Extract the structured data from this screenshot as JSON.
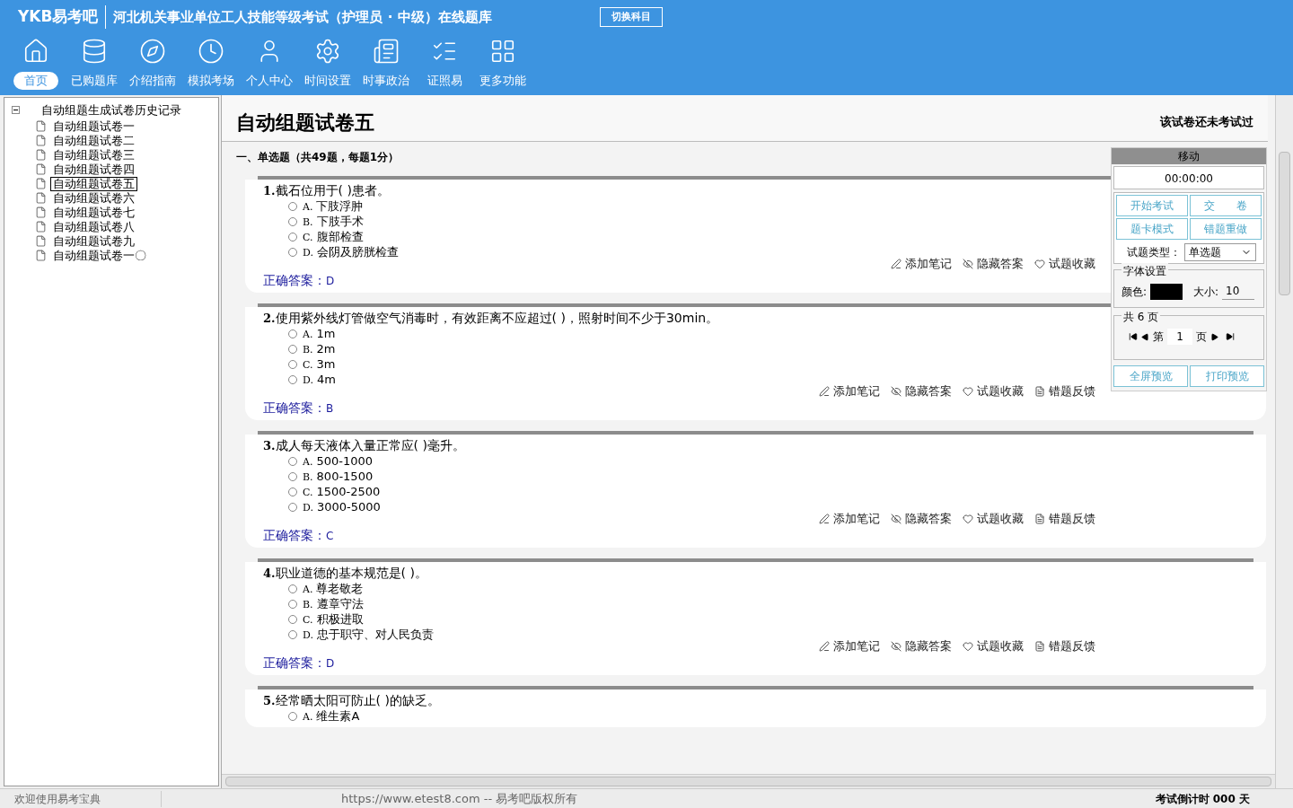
{
  "header": {
    "logo": "YKB易考吧",
    "title": "河北机关事业单位工人技能等级考试（护理员 · 中级）在线题库",
    "switch_button": "切换科目"
  },
  "nav": [
    {
      "kind": "home",
      "label": "首页",
      "selected": true
    },
    {
      "kind": "database",
      "label": "已购题库",
      "selected": false
    },
    {
      "kind": "compass",
      "label": "介绍指南",
      "selected": false
    },
    {
      "kind": "clock",
      "label": "模拟考场",
      "selected": false
    },
    {
      "kind": "user",
      "label": "个人中心",
      "selected": false
    },
    {
      "kind": "gear",
      "label": "时间设置",
      "selected": false
    },
    {
      "kind": "news",
      "label": "时事政治",
      "selected": false
    },
    {
      "kind": "list",
      "label": "证照易",
      "selected": false
    },
    {
      "kind": "grid",
      "label": "更多功能",
      "selected": false
    }
  ],
  "tree": {
    "label": "自动组题生成试卷历史记录",
    "expanded": true,
    "children": [
      {
        "label": "自动组题试卷一",
        "selected": false
      },
      {
        "label": "自动组题试卷二",
        "selected": false
      },
      {
        "label": "自动组题试卷三",
        "selected": false
      },
      {
        "label": "自动组题试卷四",
        "selected": false
      },
      {
        "label": "自动组题试卷五",
        "selected": true
      },
      {
        "label": "自动组题试卷六",
        "selected": false
      },
      {
        "label": "自动组题试卷七",
        "selected": false
      },
      {
        "label": "自动组题试卷八",
        "selected": false
      },
      {
        "label": "自动组题试卷九",
        "selected": false
      },
      {
        "label": "自动组题试卷一〇",
        "selected": false
      }
    ]
  },
  "paper": {
    "title": "自动组题试卷五",
    "status": "该试卷还未考试过",
    "section": "一、单选题（共49题，每题1分）"
  },
  "questions": [
    {
      "number": "1.",
      "text": "截石位用于( )患者。",
      "options": [
        {
          "letter": "A.",
          "text": "下肢浮肿",
          "selected": false
        },
        {
          "letter": "B.",
          "text": "下肢手术",
          "selected": false
        },
        {
          "letter": "C.",
          "text": "腹部检查",
          "selected": false
        },
        {
          "letter": "D.",
          "text": "会阴及膀胱检查",
          "selected": false
        }
      ],
      "answer_label": "正确答案：",
      "answer": "D",
      "actions": [
        {
          "kind": "note",
          "label": "添加笔记"
        },
        {
          "kind": "hide",
          "label": "隐藏答案"
        },
        {
          "kind": "fav",
          "label": "试题收藏"
        }
      ]
    },
    {
      "number": "2.",
      "text": "使用紫外线灯管做空气消毒时，有效距离不应超过( )，照射时间不少于30min。",
      "options": [
        {
          "letter": "A.",
          "text": "1m",
          "selected": false
        },
        {
          "letter": "B.",
          "text": "2m",
          "selected": false
        },
        {
          "letter": "C.",
          "text": "3m",
          "selected": false
        },
        {
          "letter": "D.",
          "text": "4m",
          "selected": false
        }
      ],
      "answer_label": "正确答案：",
      "answer": "B",
      "actions": [
        {
          "kind": "note",
          "label": "添加笔记"
        },
        {
          "kind": "hide",
          "label": "隐藏答案"
        },
        {
          "kind": "fav",
          "label": "试题收藏"
        },
        {
          "kind": "report",
          "label": "错题反馈"
        }
      ]
    },
    {
      "number": "3.",
      "text": "成人每天液体入量正常应( )毫升。",
      "options": [
        {
          "letter": "A.",
          "text": "500-1000",
          "selected": false
        },
        {
          "letter": "B.",
          "text": "800-1500",
          "selected": false
        },
        {
          "letter": "C.",
          "text": "1500-2500",
          "selected": false
        },
        {
          "letter": "D.",
          "text": "3000-5000",
          "selected": false
        }
      ],
      "answer_label": "正确答案：",
      "answer": "C",
      "actions": [
        {
          "kind": "note",
          "label": "添加笔记"
        },
        {
          "kind": "hide",
          "label": "隐藏答案"
        },
        {
          "kind": "fav",
          "label": "试题收藏"
        },
        {
          "kind": "report",
          "label": "错题反馈"
        }
      ]
    },
    {
      "number": "4.",
      "text": "职业道德的基本规范是( )。",
      "options": [
        {
          "letter": "A.",
          "text": "尊老敬老",
          "selected": false
        },
        {
          "letter": "B.",
          "text": "遵章守法",
          "selected": false
        },
        {
          "letter": "C.",
          "text": "积极进取",
          "selected": false
        },
        {
          "letter": "D.",
          "text": "忠于职守、对人民负责",
          "selected": false
        }
      ],
      "answer_label": "正确答案：",
      "answer": "D",
      "actions": [
        {
          "kind": "note",
          "label": "添加笔记"
        },
        {
          "kind": "hide",
          "label": "隐藏答案"
        },
        {
          "kind": "fav",
          "label": "试题收藏"
        },
        {
          "kind": "report",
          "label": "错题反馈"
        }
      ]
    },
    {
      "number": "5.",
      "text": "经常晒太阳可防止( )的缺乏。",
      "options": [
        {
          "letter": "A.",
          "text": "维生素A",
          "selected": false
        }
      ]
    }
  ],
  "panel": {
    "title": "移动",
    "timer": "00:00:00",
    "buttons": [
      "开始考试",
      "交　　卷",
      "题卡模式",
      "错题重做"
    ],
    "type_label": "试题类型：",
    "type_value": "单选题",
    "font_group": "字体设置",
    "color_label": "颜色:",
    "size_label": "大小:",
    "size_value": "10",
    "pages_group": "共 6 页",
    "page_prefix": "第",
    "page_value": "1",
    "page_suffix": "页",
    "bottom_buttons": [
      "全屏预览",
      "打印预览"
    ]
  },
  "status_bar": {
    "welcome": "欢迎使用易考宝典",
    "copyright": "https://www.etest8.com -- 易考吧版权所有",
    "countdown": "考试倒计时 000 天"
  }
}
